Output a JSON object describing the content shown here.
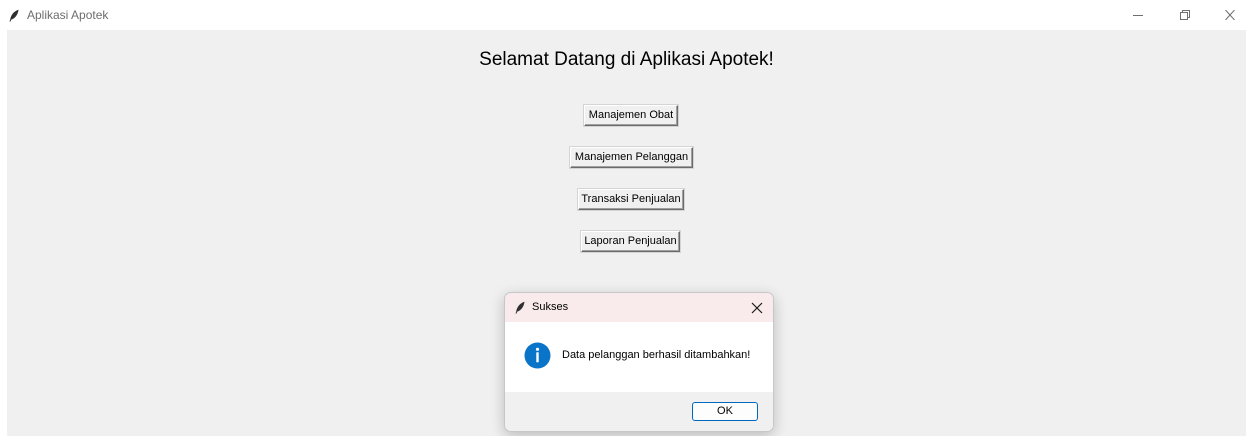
{
  "window": {
    "title": "Aplikasi Apotek",
    "icon": "feather-icon",
    "controls": [
      "minimize-icon",
      "restore-icon",
      "close-icon"
    ]
  },
  "main": {
    "heading": "Selamat Datang di Aplikasi Apotek!",
    "buttons": [
      {
        "label": "Manajemen Obat"
      },
      {
        "label": "Manajemen Pelanggan"
      },
      {
        "label": "Transaksi Penjualan"
      },
      {
        "label": "Laporan Penjualan"
      }
    ]
  },
  "dialog": {
    "title": "Sukses",
    "message": "Data pelanggan berhasil ditambahkan!",
    "icon": "info-icon",
    "ok_label": "OK",
    "accent_color": "#0078d4"
  }
}
